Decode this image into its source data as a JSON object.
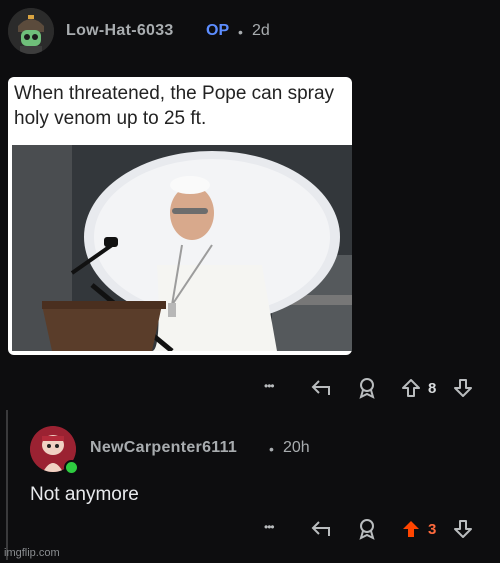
{
  "op_comment": {
    "username": "Low-Hat-6033",
    "badge": "OP",
    "separator": "•",
    "age": "2d",
    "meme_caption": "When threatened, the Pope can spray holy venom up to 25 ft.",
    "score": "8",
    "more_label": "•••"
  },
  "reply_comment": {
    "username": "NewCarpenter6111",
    "separator": "•",
    "age": "20h",
    "body": "Not anymore",
    "score": "3",
    "more_label": "•••",
    "upvote_color": "#ff4500",
    "score_color": "#ff6a3d"
  },
  "watermark": "imgflip.com",
  "icons": [
    "more-icon",
    "reply-icon",
    "award-icon",
    "upvote-icon",
    "downvote-icon"
  ],
  "colors": {
    "background": "#0d0d0f",
    "username": "#a8acaf",
    "op_badge": "#5c8dff",
    "online": "#2ecc40"
  }
}
